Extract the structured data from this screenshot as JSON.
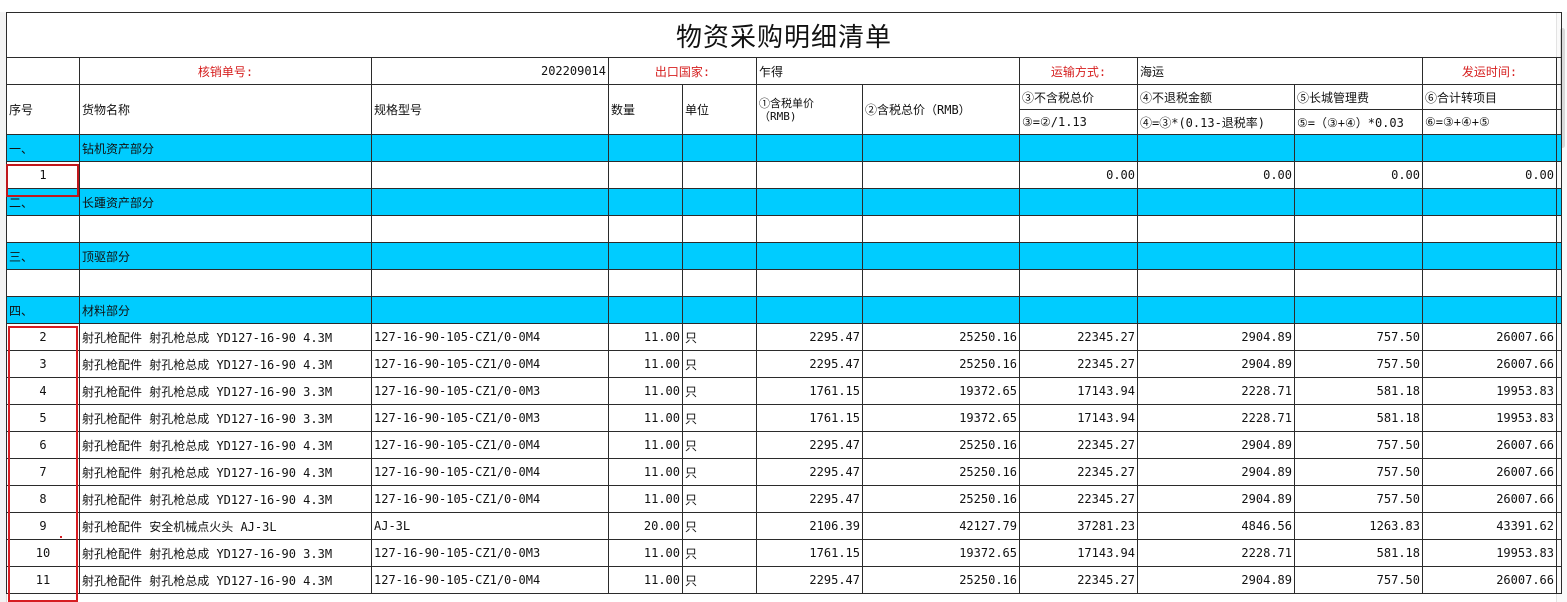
{
  "sheet": {
    "title": "物资采购明细清单",
    "info": {
      "order_label": "核销单号:",
      "order_value": "202209014",
      "country_label": "出口国家:",
      "country_value": "乍得",
      "transport_label": "运输方式:",
      "transport_value": "海运",
      "ship_label": "发运时间:",
      "ship_value": ""
    },
    "headers": {
      "seq": "序号",
      "name": "货物名称",
      "spec": "规格型号",
      "qty": "数量",
      "unit": "单位",
      "price_line1": "①含税单价",
      "price_line2": "（RMB)",
      "total": "②含税总价（RMB）",
      "notax": "③不含税总价",
      "notax_formula": "③=②/1.13",
      "norefund": "④不退税金额",
      "norefund_formula": "④=③*(0.13-退税率)",
      "fee": "⑤长城管理费",
      "fee_formula": "⑤=（③+④）*0.03",
      "sum": "⑥合计转项目",
      "sum_formula": "⑥=③+④+⑤"
    },
    "sections": {
      "s1_no": "一、",
      "s1_name": "钻机资产部分",
      "s2_no": "二、",
      "s2_name": "长踵资产部分",
      "s3_no": "三、",
      "s3_name": "顶驱部分",
      "s4_no": "四、",
      "s4_name": "材料部分"
    },
    "row1": {
      "no": "1",
      "notax": "0.00",
      "norefund": "0.00",
      "fee": "0.00",
      "sum": "0.00"
    },
    "rows": [
      {
        "no": "2",
        "name": "射孔枪配件 射孔枪总成 YD127-16-90 4.3M",
        "spec": "127-16-90-105-CZ1/0-0M4",
        "qty": "11.00",
        "unit": "只",
        "price": "2295.47",
        "total": "25250.16",
        "notax": "22345.27",
        "norefund": "2904.89",
        "fee": "757.50",
        "sum": "26007.66"
      },
      {
        "no": "3",
        "name": "射孔枪配件 射孔枪总成 YD127-16-90 4.3M",
        "spec": "127-16-90-105-CZ1/0-0M4",
        "qty": "11.00",
        "unit": "只",
        "price": "2295.47",
        "total": "25250.16",
        "notax": "22345.27",
        "norefund": "2904.89",
        "fee": "757.50",
        "sum": "26007.66"
      },
      {
        "no": "4",
        "name": "射孔枪配件 射孔枪总成 YD127-16-90 3.3M",
        "spec": "127-16-90-105-CZ1/0-0M3",
        "qty": "11.00",
        "unit": "只",
        "price": "1761.15",
        "total": "19372.65",
        "notax": "17143.94",
        "norefund": "2228.71",
        "fee": "581.18",
        "sum": "19953.83"
      },
      {
        "no": "5",
        "name": "射孔枪配件 射孔枪总成 YD127-16-90 3.3M",
        "spec": "127-16-90-105-CZ1/0-0M3",
        "qty": "11.00",
        "unit": "只",
        "price": "1761.15",
        "total": "19372.65",
        "notax": "17143.94",
        "norefund": "2228.71",
        "fee": "581.18",
        "sum": "19953.83"
      },
      {
        "no": "6",
        "name": "射孔枪配件 射孔枪总成 YD127-16-90 4.3M",
        "spec": "127-16-90-105-CZ1/0-0M4",
        "qty": "11.00",
        "unit": "只",
        "price": "2295.47",
        "total": "25250.16",
        "notax": "22345.27",
        "norefund": "2904.89",
        "fee": "757.50",
        "sum": "26007.66"
      },
      {
        "no": "7",
        "name": "射孔枪配件 射孔枪总成 YD127-16-90 4.3M",
        "spec": "127-16-90-105-CZ1/0-0M4",
        "qty": "11.00",
        "unit": "只",
        "price": "2295.47",
        "total": "25250.16",
        "notax": "22345.27",
        "norefund": "2904.89",
        "fee": "757.50",
        "sum": "26007.66"
      },
      {
        "no": "8",
        "name": "射孔枪配件 射孔枪总成 YD127-16-90 4.3M",
        "spec": "127-16-90-105-CZ1/0-0M4",
        "qty": "11.00",
        "unit": "只",
        "price": "2295.47",
        "total": "25250.16",
        "notax": "22345.27",
        "norefund": "2904.89",
        "fee": "757.50",
        "sum": "26007.66"
      },
      {
        "no": "9",
        "name": "射孔枪配件 安全机械点火头 AJ-3L",
        "spec": "AJ-3L",
        "qty": "20.00",
        "unit": "只",
        "price": "2106.39",
        "total": "42127.79",
        "notax": "37281.23",
        "norefund": "4846.56",
        "fee": "1263.83",
        "sum": "43391.62"
      },
      {
        "no": "10",
        "name": "射孔枪配件 射孔枪总成 YD127-16-90 3.3M",
        "spec": "127-16-90-105-CZ1/0-0M3",
        "qty": "11.00",
        "unit": "只",
        "price": "1761.15",
        "total": "19372.65",
        "notax": "17143.94",
        "norefund": "2228.71",
        "fee": "581.18",
        "sum": "19953.83"
      },
      {
        "no": "11",
        "name": "射孔枪配件 射孔枪总成 YD127-16-90 4.3M",
        "spec": "127-16-90-105-CZ1/0-0M4",
        "qty": "11.00",
        "unit": "只",
        "price": "2295.47",
        "total": "25250.16",
        "notax": "22345.27",
        "norefund": "2904.89",
        "fee": "757.50",
        "sum": "26007.66"
      }
    ]
  }
}
